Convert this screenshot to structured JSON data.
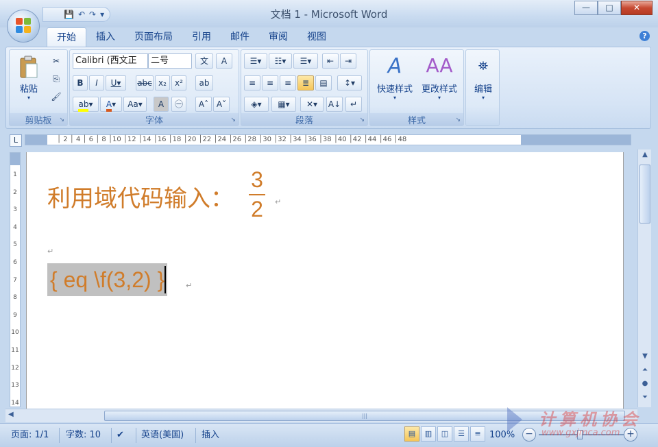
{
  "window": {
    "title": "文档 1 - Microsoft Word",
    "controls": {
      "minimize": "—",
      "maximize": "□",
      "close": "✕"
    }
  },
  "quick_access": {
    "save": "💾",
    "undo": "↶",
    "redo": "↷",
    "customize": "▾"
  },
  "tabs": [
    {
      "label": "开始",
      "active": true
    },
    {
      "label": "插入"
    },
    {
      "label": "页面布局"
    },
    {
      "label": "引用"
    },
    {
      "label": "邮件"
    },
    {
      "label": "审阅"
    },
    {
      "label": "视图"
    }
  ],
  "ribbon": {
    "clipboard": {
      "label": "剪贴板",
      "paste": "粘贴"
    },
    "font": {
      "label": "字体",
      "name": "Calibri (西文正",
      "size": "二号"
    },
    "paragraph": {
      "label": "段落"
    },
    "styles": {
      "label": "样式",
      "quick_styles": "快速样式",
      "change_styles": "更改样式"
    },
    "editing": {
      "label": "编辑",
      "edit": "编辑"
    }
  },
  "ruler": {
    "numbers": "│ 2 │ 4 │ 6 │ 8 │10 │12 │14 │16 │18 │20 │22 │24 │26 │28 │30 │32 │34 │36 │38 │40 │42 │44 │46 │48",
    "vertical": [
      "1",
      "2",
      "3",
      "4",
      "5",
      "6",
      "7",
      "8",
      "9",
      "10",
      "11",
      "12",
      "13",
      "14"
    ]
  },
  "document": {
    "line1_text": "利用域代码输入：",
    "fraction_num": "3",
    "fraction_den": "2",
    "field_code": "{  eq \\f(3,2)  }",
    "para_mark": "↵"
  },
  "status": {
    "page": "页面: 1/1",
    "words": "字数: 10",
    "language": "英语(美国)",
    "mode": "插入",
    "zoom": "100%"
  },
  "watermark": {
    "line1": "计算机协会",
    "line2": "www.gxjmca.com"
  },
  "colors": {
    "text_accent": "#d07c2a",
    "field_shade": "#c0c0c0"
  }
}
